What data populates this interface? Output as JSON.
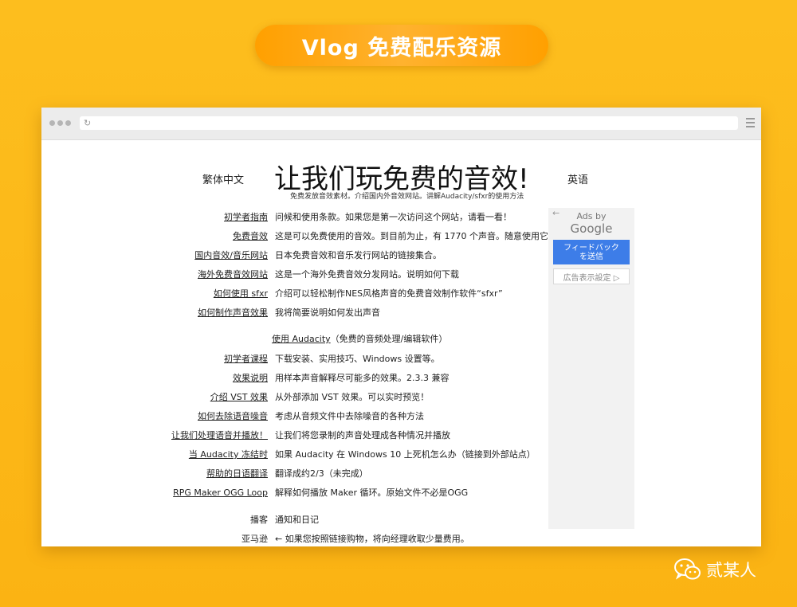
{
  "banner": {
    "title": "Vlog 免费配乐资源"
  },
  "browser": {
    "url": ""
  },
  "page": {
    "lang_left": "繁体中文",
    "lang_right": "英语",
    "title": "让我们玩免费的音效!",
    "subtitle": "免费发放音效素材。介绍国内外音效网站。讲解Audacity/sfxr的使用方法"
  },
  "rows": [
    {
      "link": "初学者指南",
      "desc": "问候和使用条款。如果您是第一次访问这个网站，请看一看！"
    },
    {
      "link": "免费音效",
      "desc": "这是可以免费使用的音效。到目前为止，有 1770 个声音。随意使用它"
    },
    {
      "link": "国内音效/音乐网站",
      "desc": "日本免费音效和音乐发行网站的链接集合。"
    },
    {
      "link": "海外免费音效网站",
      "desc": "这是一个海外免费音效分发网站。说明如何下载"
    },
    {
      "link": "如何使用 sfxr",
      "desc": "介绍可以轻松制作NES风格声音的免费音效制作软件“sfxr”"
    },
    {
      "link": "如何制作声音效果",
      "desc": "我将简要说明如何发出声音"
    }
  ],
  "audacity": {
    "link": "使用 Audacity",
    "desc": "（免费的音频处理/编辑软件）"
  },
  "rows2": [
    {
      "link": "初学者课程",
      "desc": "下载安装、实用技巧、Windows 设置等。"
    },
    {
      "link": "效果说明",
      "desc": "用样本声音解释尽可能多的效果。2.3.3 兼容"
    },
    {
      "link": "介绍 VST 效果",
      "desc": "从外部添加 VST 效果。可以实时预览！"
    },
    {
      "link": "如何去除语音噪音",
      "desc": "考虑从音频文件中去除噪音的各种方法"
    },
    {
      "link": "让我们处理语音并播放！",
      "desc": "让我们将您录制的声音处理成各种情况并播放"
    },
    {
      "link": "当 Audacity 冻结时",
      "desc": "如果 Audacity 在 Windows 10 上死机怎么办（链接到外部站点）"
    },
    {
      "link": "帮助的日语翻译",
      "desc": "翻译成约2/3（未完成）"
    },
    {
      "link": "RPG Maker OGG Loop",
      "desc": "解释如何播放 Maker 循环。原始文件不必是OGG"
    }
  ],
  "rows3": [
    {
      "label": "播客",
      "desc": "通知和日记"
    },
    {
      "label": "亚马逊",
      "desc": "← 如果您按照链接购物，将向经理收取少量费用。"
    }
  ],
  "ad": {
    "ads_by": "Ads by",
    "google": "Google",
    "feedback_line1": "フィードバック",
    "feedback_line2": "を送信",
    "settings": "広告表示設定 ▷"
  },
  "brand": {
    "name": "贰某人"
  }
}
